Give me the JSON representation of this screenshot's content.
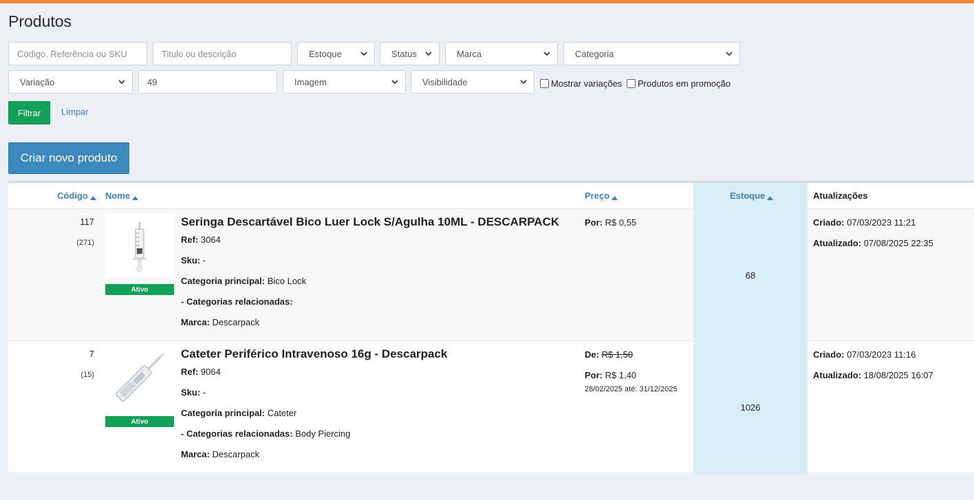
{
  "page": {
    "title": "Produtos"
  },
  "filters": {
    "code_placeholder": "Código, Referência ou SKU",
    "title_placeholder": "Titulo ou descrição",
    "estoque": "Estoque",
    "status": "Status",
    "marca": "Marca",
    "categoria": "Categoria",
    "variacao": "Variação",
    "per_page_value": "49",
    "imagem": "Imagem",
    "visibilidade": "Visibilidade",
    "show_variations": "Mostrar variações",
    "promo_products": "Produtos em promoção",
    "filter_button": "Filtrar",
    "clear_link": "Limpar"
  },
  "actions": {
    "create_button": "Criar novo produto"
  },
  "table": {
    "headers": {
      "code": "Código",
      "name": "Nome",
      "price": "Preço",
      "stock": "Estoque",
      "updates": "Atualizações"
    },
    "labels": {
      "ref": "Ref:",
      "sku": "Sku:",
      "main_category": "Categoria principal:",
      "related_categories": "- Categorias relacionadas:",
      "brand": "Marca:",
      "from": "De:",
      "by": "Por:",
      "created": "Criado:",
      "updated": "Atualizado:"
    },
    "rows": [
      {
        "code": "117",
        "count": "(271)",
        "status": "Ativo",
        "image_icon": "syringe-icon",
        "name": "Seringa Descartável Bico Luer Lock S/Agulha 10ML - DESCARPACK",
        "ref": "3064",
        "sku": "-",
        "main_category": "Bico Lock",
        "related_categories": "",
        "brand": "Descarpack",
        "price_por": "R$ 0,55",
        "stock": "68",
        "created": "07/03/2023 11:21",
        "updated": "07/08/2025 22:35"
      },
      {
        "code": "7",
        "count": "(15)",
        "status": "Ativo",
        "image_icon": "catheter-icon",
        "name": "Cateter Periférico Intravenoso 16g - Descarpack",
        "ref": "9064",
        "sku": "-",
        "main_category": "Cateter",
        "related_categories": "Body Piercing",
        "brand": "Descarpack",
        "price_de": "R$ 1,50",
        "price_por": "R$ 1,40",
        "price_range": "28/02/2025 até: 31/12/2025",
        "stock": "1026",
        "created": "07/03/2023 11:16",
        "updated": "18/08/2025 16:07"
      }
    ]
  },
  "colors": {
    "accent_top": "#f58a3c",
    "filter_green": "#13a15a",
    "create_blue": "#3c89bd",
    "link_blue": "#3c83b9",
    "stock_col": "#d9edf7"
  }
}
